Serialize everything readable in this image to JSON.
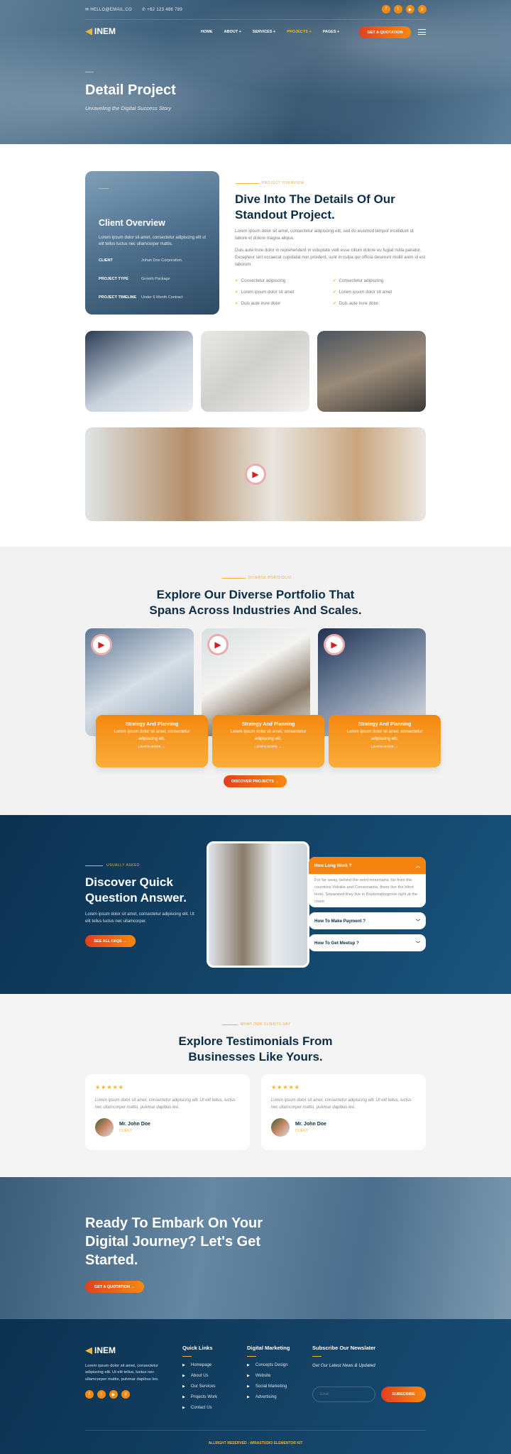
{
  "topbar": {
    "email": "HELLO@EMAIL.CO",
    "phone": "+62 123 486 789",
    "social": [
      "facebook-icon",
      "twitter-icon",
      "youtube-icon",
      "pinterest-icon"
    ]
  },
  "nav": {
    "logo": "INEM",
    "items": [
      "HOME",
      "ABOUT +",
      "SERVICES +",
      "PROJECTS +",
      "PAGES +"
    ],
    "active": "PROJECTS +",
    "cta": "GET A QUOTATION"
  },
  "hero": {
    "title": "Detail Project",
    "subtitle": "Unraveling the Digital Success Story"
  },
  "client": {
    "title": "Client Overview",
    "text": "Lorem ipsum dolor sit amet, consectetur adipiscing elit ut elit tellus luctus nec ullamcorper mattis.",
    "rows": [
      {
        "k": "CLIENT",
        "v": "Johan Doe Corporation."
      },
      {
        "k": "PROJECT TYPE",
        "v": "Growth Package"
      },
      {
        "k": "PROJECT TIMELINE",
        "v": "Under 6 Month Contract"
      }
    ]
  },
  "overview": {
    "label": "PROJECT OVERVIEW",
    "title": "Dive Into The Details Of Our Standout Project.",
    "p1": "Lorem ipsum dolor sit amet, consectetur adipiscing elit, sed do eiusmod tempor incididunt ut labore et dolore magna aliqua.",
    "p2": "Duis aute irure dolor in reprehenderit in voluptate velit esse cillum dolore eu fugiat nulla pariatur. Excepteur sint occaecat cupidatat non proident, sunt in culpa qui officia deserunt mollit anim id est laborum.",
    "checks": [
      "Consectetur adipiscing",
      "Consectetur adipiscing",
      "Lorem ipsum dolor sit amet",
      "Lorem ipsum dolor sit amet",
      "Duis aute irure dolor",
      "Duis aute irure dolor"
    ]
  },
  "portfolio": {
    "label": "DIVERSE PORTFOLIO",
    "title": "Explore Our Diverse Portfolio That Spans Across Industries And Scales.",
    "cards": [
      {
        "title": "Strategy And Planning",
        "text": "Lorem ipsum dolor sit amet, consectetur adipiscing elit.",
        "link": "LEARN MORE →"
      },
      {
        "title": "Strategy And Planning",
        "text": "Lorem ipsum dolor sit amet, consectetur adipiscing elit.",
        "link": "LEARN MORE →"
      },
      {
        "title": "Strategy And Planning",
        "text": "Lorem ipsum dolor sit amet, consectetur adipiscing elit.",
        "link": "LEARN MORE →"
      }
    ],
    "button": "DISCOVER PROJECTS →"
  },
  "faq": {
    "label": "USUALLY ASKED",
    "title": "Discover Quick Question Answer.",
    "text": "Lorem ipsum dolor sit amet, consectetur adipiscing elit. Ut elit tellus luctus nec ullamcorper.",
    "button": "SEE ALL FAQS →",
    "items": [
      {
        "q": "How Long Work ?",
        "a": "For far away, behind the word mountains, far from the countries Vokalia and Consonantia, there live the blind texts. Separated they live in Bookmarksgrove right at the coast",
        "open": true
      },
      {
        "q": "How To Make Payment ?",
        "open": false
      },
      {
        "q": "How To Get Meetup ?",
        "open": false
      }
    ]
  },
  "testimonials": {
    "label": "WHAT OUR CLIENTS SAY",
    "title": "Explore Testimonials From Businesses Like Yours.",
    "items": [
      {
        "rating": 5,
        "stars": "★★★★★",
        "text": "Lorem ipsum dolor sit amet, consectetur adipiscing elit. Ut elit tellus, luctus nec ullamcorper mattis, pulvinar dapibus leo.",
        "name": "Mr. John Doe",
        "role": "CLIENT"
      },
      {
        "rating": 5,
        "stars": "★★★★★",
        "text": "Lorem ipsum dolor sit amet, consectetur adipiscing elit. Ut elit tellus, luctus nec ullamcorper mattis, pulvinar dapibus leo.",
        "name": "Mr. John Doe",
        "role": "CLIENT"
      }
    ]
  },
  "cta": {
    "title": "Ready To Embark On Your Digital Journey? Let's Get Started.",
    "button": "GET A QUOTATION →"
  },
  "footer": {
    "about": "Lorem ipsum dolor sit amet, consectetur adipiscing elit. Ut elit tellus, luctus nec ullamcorper mattis, pulvinar dapibus leo.",
    "quick_title": "Quick Links",
    "quick": [
      "Homepage",
      "About Us",
      "Our Services",
      "Projects Work",
      "Contact Us"
    ],
    "dm_title": "Digital Marketing",
    "dm": [
      "Concepts Design",
      "Website",
      "Social Marketing",
      "Advertising"
    ],
    "news_title": "Subscribe Our Newslater",
    "news_sub": "Get Our Latest News & Updated",
    "email_placeholder": "Email",
    "subscribe": "SUBSCRIBE",
    "copyright": "ALLRIGHT RESERVED - WIRASTUDIO ELEMENTOR KIT"
  },
  "colors": {
    "navy": "#0d2d44",
    "orange": "#f7890f",
    "red": "#e2401f",
    "gold": "#f0b43b"
  }
}
